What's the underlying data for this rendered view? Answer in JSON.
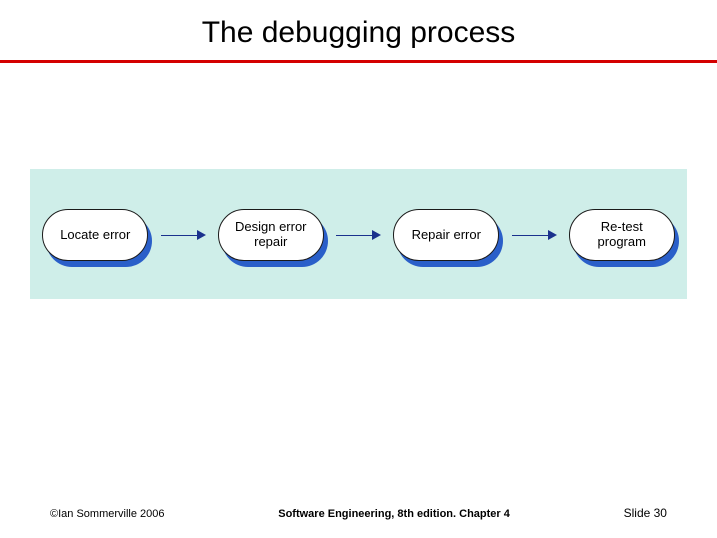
{
  "title": "The debugging process",
  "diagram": {
    "nodes": [
      {
        "label": "Locate error"
      },
      {
        "label": "Design error repair"
      },
      {
        "label": "Repair error"
      },
      {
        "label": "Re-test program"
      }
    ]
  },
  "footer": {
    "left": "©Ian Sommerville 2006",
    "center": "Software Engineering, 8th edition. Chapter 4",
    "right": "Slide 30"
  }
}
